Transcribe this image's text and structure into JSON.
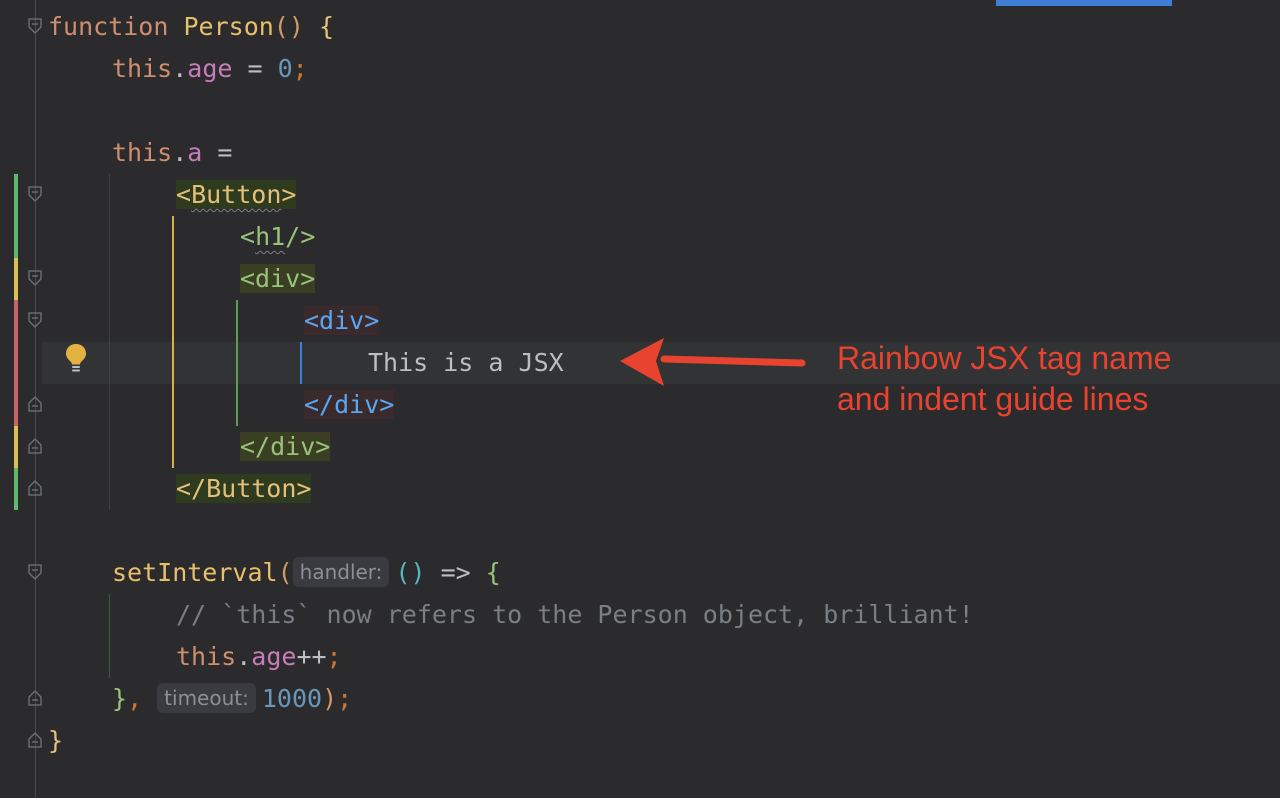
{
  "code": {
    "l1": {
      "kw": "function",
      "name": "Person",
      "parens": "()",
      "brace": "{"
    },
    "l2": {
      "this": "this",
      "dot": ".",
      "prop": "age",
      "eq": " = ",
      "val": "0",
      "semi": ";"
    },
    "l4": {
      "this": "this",
      "dot": ".",
      "prop": "a",
      "eq": " ="
    },
    "l5": {
      "tag_open": "<",
      "tag_name": "Button",
      "tag_close": ">"
    },
    "l6": {
      "tag": "<h1/>",
      "open": "<",
      "name": "h1",
      "close": "/>"
    },
    "l7": {
      "tag": "<div>"
    },
    "l8": {
      "tag": "<div>"
    },
    "l9": {
      "text": "This is a JSX"
    },
    "l10": {
      "tag": "</div>"
    },
    "l11": {
      "tag": "</div>"
    },
    "l12": {
      "tag": "</Button>"
    },
    "l14": {
      "fn": "setInterval",
      "paren": "(",
      "hint": "handler:",
      "arrow_parens": "()",
      "arrow": " => ",
      "brace": "{"
    },
    "l15": {
      "comment": "// `this` now refers to the Person object, brilliant!"
    },
    "l16": {
      "this": "this",
      "dot": ".",
      "prop": "age",
      "op": "++",
      "semi": ";"
    },
    "l17": {
      "brace": "}",
      "comma": ", ",
      "hint": "timeout:",
      "val": "1000",
      "paren": ")",
      "semi": ";"
    },
    "l18": {
      "brace": "}"
    }
  },
  "annotation": {
    "line1": "Rainbow JSX tag name",
    "line2": "and indent guide lines",
    "color": "#e8432e"
  },
  "icons": {
    "intention": "lightbulb-icon",
    "fold": "fold-marker-icon"
  }
}
